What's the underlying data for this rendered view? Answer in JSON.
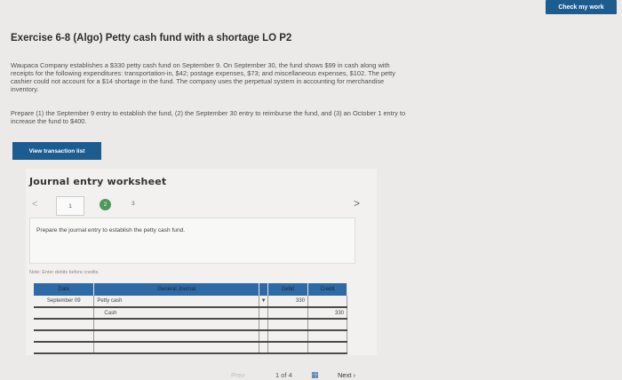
{
  "header": {
    "check_work": "Check my work"
  },
  "exercise": {
    "title": "Exercise 6-8 (Algo) Petty cash fund with a shortage LO P2",
    "paragraph1_lines": [
      "Waupaca Company establishes a $330 petty cash fund on September 9. On September 30, the fund shows $99 in cash along with",
      "receipts for the following expenditures: transportation-in, $42; postage expenses, $73; and miscellaneous expenses, $102. The petty",
      "cashier could not account for a $14 shortage in the fund. The company uses the perpetual system in accounting for merchandise",
      "inventory."
    ],
    "paragraph2_lines": [
      "Prepare (1) the September 9 entry to establish the fund, (2) the September 30 entry to reimburse the fund, and (3) an October 1 entry to",
      "increase the fund to $400."
    ]
  },
  "buttons": {
    "view_transactions": "View transaction list"
  },
  "worksheet": {
    "title": "Journal entry worksheet",
    "prev_arrow": "<",
    "next_arrow": ">",
    "steps": [
      "1",
      "2",
      "3"
    ],
    "prompt": "Prepare the journal entry to establish the petty cash fund.",
    "note": "Note: Enter debits before credits.",
    "columns": {
      "date": "Date",
      "general_journal": "General Journal",
      "debit": "Debit",
      "credit": "Credit"
    },
    "rows": [
      {
        "date": "September 09",
        "account": "Petty cash",
        "debit": "330",
        "credit": ""
      },
      {
        "date": "",
        "account": "Cash",
        "debit": "",
        "credit": "330"
      },
      {
        "date": "",
        "account": "",
        "debit": "",
        "credit": ""
      },
      {
        "date": "",
        "account": "",
        "debit": "",
        "credit": ""
      },
      {
        "date": "",
        "account": "",
        "debit": "",
        "credit": ""
      }
    ],
    "dropdown_caret": "▼"
  },
  "pager": {
    "prev": "Prev",
    "count": "1 of 4",
    "grid_icon": "grid-icon",
    "next": "Next"
  },
  "colors": {
    "accent": "#1d5c8f",
    "header": "#2d6aa6",
    "step_done": "#4c9a5a"
  }
}
